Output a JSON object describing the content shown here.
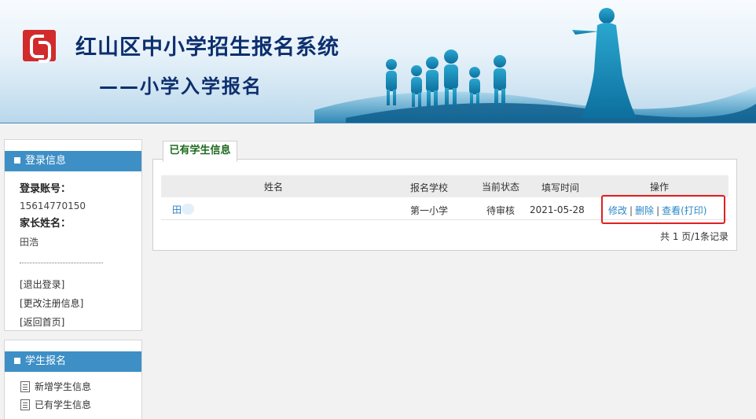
{
  "header": {
    "title": "红山区中小学招生报名系统",
    "subtitle": "——小学入学报名"
  },
  "login_panel": {
    "heading": "登录信息",
    "account_label": "登录账号：",
    "account_value": "15614770150",
    "parent_label": "家长姓名：",
    "parent_value": "田浩",
    "links": [
      "[退出登录]",
      "[更改注册信息]",
      "[返回首页]"
    ]
  },
  "student_panel": {
    "heading": "学生报名",
    "items": [
      "新增学生信息",
      "已有学生信息"
    ]
  },
  "main": {
    "tab_label": "已有学生信息",
    "columns": [
      "姓名",
      "报名学校",
      "当前状态",
      "填写时间",
      "操作"
    ],
    "rows": [
      {
        "name": "田",
        "school": "第一小学",
        "status": "待审核",
        "date": "2021-05-28",
        "actions": {
          "edit": "修改",
          "delete": "删除",
          "view": "查看(打印)"
        }
      }
    ],
    "pager_text": "共 1 页/1条记录"
  },
  "colors": {
    "panel_head": "#3d8fc6",
    "link": "#2a88c6",
    "highlight_border": "#e02020",
    "title": "#0d2f6e"
  }
}
